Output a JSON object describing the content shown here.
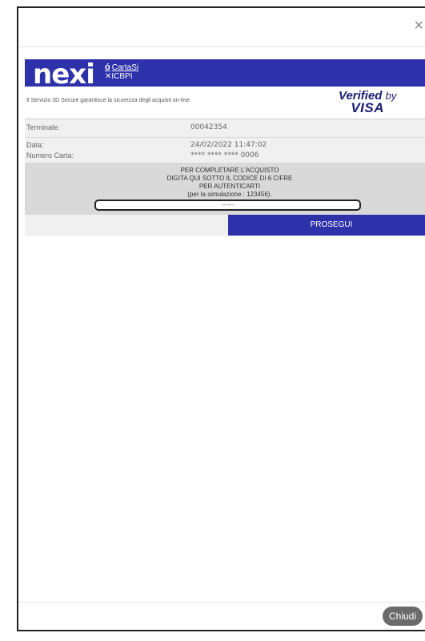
{
  "modal": {
    "close_symbol": "×",
    "close_label": "Chiudi"
  },
  "brand": {
    "logo_text": "nexi",
    "cartasi_text": "CartaSi",
    "cartasi_mark": "ó",
    "icbpi_text": "ICBPI",
    "color": "#2d32aa"
  },
  "info": {
    "text": "Il Servizio 3D Secure garantisce la sicurezza degli acquisti on-line.",
    "badge_line1": "Verified",
    "badge_by": "by",
    "badge_line2": "VISA"
  },
  "details": {
    "terminale_label": "Terminale:",
    "terminale_value": "00042354",
    "data_label": "Data:",
    "data_value": "24/02/2022 11:47:02",
    "carta_label": "Numero Carta:",
    "carta_value": "**** **** **** 0006"
  },
  "instructions": {
    "line1": "PER COMPLETARE L'ACQUISTO",
    "line2": "DIGITA QUI SOTTO IL CODICE DI 6 CIFRE",
    "line3": "PER AUTENTICARTI",
    "line4": "(per la simulazione : 123456).",
    "otp_value": "------"
  },
  "actions": {
    "prosegui_label": "PROSEGUI"
  }
}
